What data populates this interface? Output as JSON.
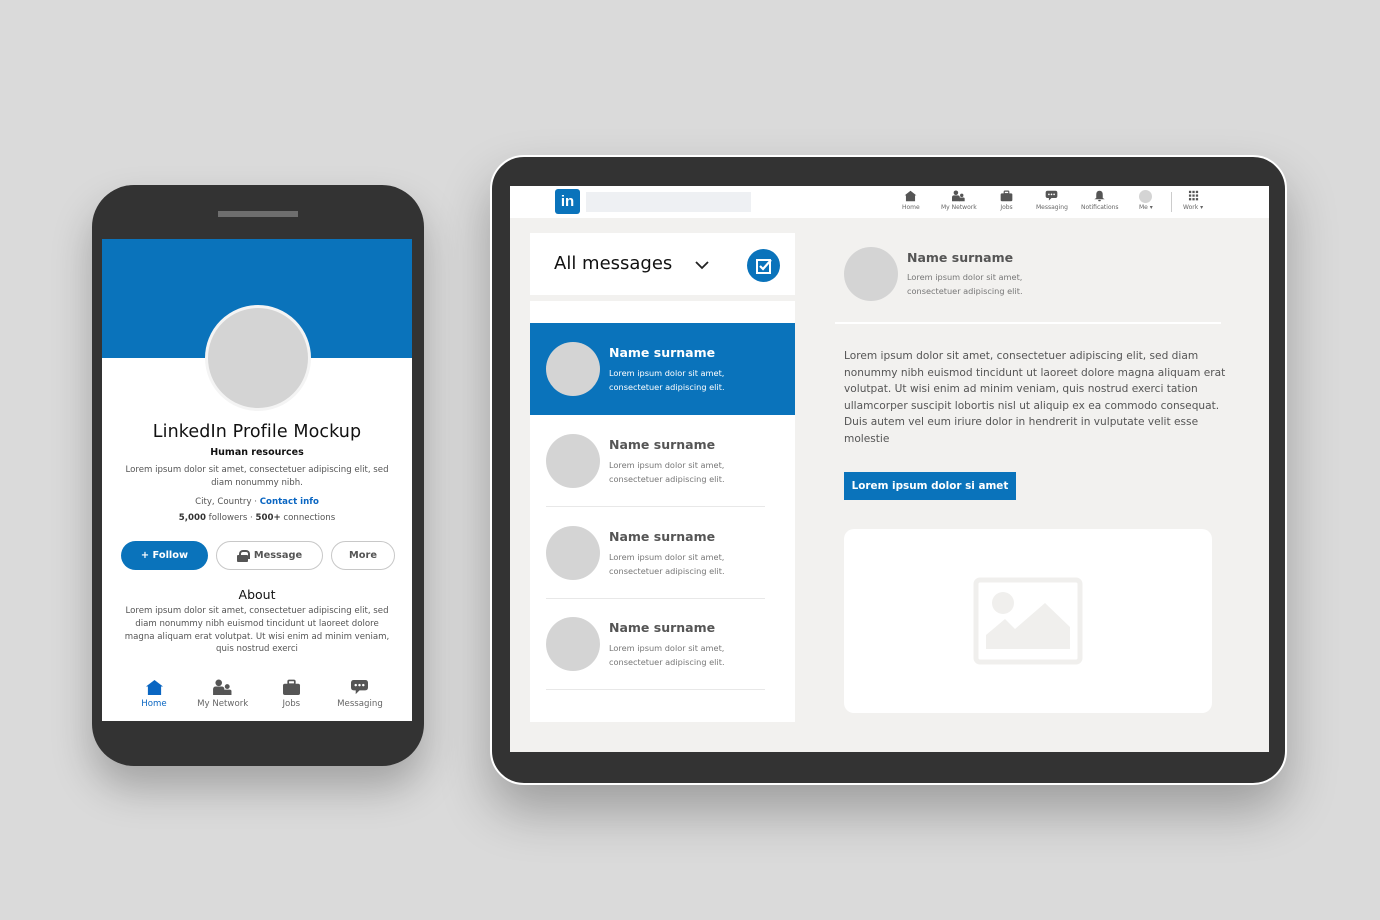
{
  "colors": {
    "brand_blue": "#0a73bb",
    "link_blue": "#0a66c2",
    "device_frame": "#333333",
    "background": "#dadada",
    "tablet_screen_bg": "#f2f1ef",
    "placeholder_gray": "#d4d4d4"
  },
  "phone": {
    "profile": {
      "name": "LinkedIn Profile Mockup",
      "headline": "Human resources",
      "summary": "Lorem ipsum dolor sit amet, consectetuer adipiscing elit, sed diam nonummy nibh.",
      "location": "City, Country",
      "location_separator": " · ",
      "contact_link": "Contact info",
      "followers_count": "5,000",
      "followers_label": " followers · ",
      "connections_count": "500+",
      "connections_label": " connections"
    },
    "buttons": {
      "follow": "+ Follow",
      "message": "Message",
      "more": "More"
    },
    "about": {
      "title": "About",
      "text": "Lorem ipsum dolor sit amet, consectetuer adipiscing elit, sed diam nonummy nibh euismod tincidunt ut laoreet dolore magna aliquam erat volutpat. Ut wisi enim ad minim veniam, quis nostrud exerci"
    },
    "bottom_nav": [
      {
        "label": "Home",
        "icon": "home-icon",
        "active": true
      },
      {
        "label": "My Network",
        "icon": "people-icon",
        "active": false
      },
      {
        "label": "Jobs",
        "icon": "briefcase-icon",
        "active": false
      },
      {
        "label": "Messaging",
        "icon": "chat-icon",
        "active": false
      }
    ]
  },
  "tablet": {
    "logo_text": "in",
    "search": {
      "value": "",
      "placeholder": ""
    },
    "top_nav": [
      {
        "label": "Home",
        "icon": "home-icon"
      },
      {
        "label": "My Network",
        "icon": "people-icon"
      },
      {
        "label": "Jobs",
        "icon": "briefcase-icon"
      },
      {
        "label": "Messaging",
        "icon": "chat-icon"
      },
      {
        "label": "Notifications",
        "icon": "bell-icon"
      },
      {
        "label": "Me ▾",
        "icon": "avatar"
      },
      {
        "label": "Work ▾",
        "icon": "grid-icon"
      }
    ],
    "messages": {
      "title": "All messages",
      "items": [
        {
          "name": "Name surname",
          "snippet": "Lorem ipsum dolor sit amet, consectetuer adipiscing elit.",
          "active": true
        },
        {
          "name": "Name surname",
          "snippet": "Lorem ipsum dolor sit amet, consectetuer adipiscing elit.",
          "active": false
        },
        {
          "name": "Name surname",
          "snippet": "Lorem ipsum dolor sit amet, consectetuer adipiscing elit.",
          "active": false
        },
        {
          "name": "Name surname",
          "snippet": "Lorem ipsum dolor sit amet, consectetuer adipiscing elit.",
          "active": false
        }
      ]
    },
    "conversation": {
      "name": "Name surname",
      "subtitle": "Lorem ipsum dolor sit amet, consectetuer adipiscing elit.",
      "body": "Lorem ipsum dolor sit amet, consectetuer adipiscing elit, sed diam nonummy nibh euismod tincidunt ut laoreet dolore magna aliquam erat volutpat. Ut wisi enim ad minim veniam, quis nostrud exerci tation ullamcorper suscipit lobortis nisl ut aliquip ex ea commodo consequat. Duis autem vel eum iriure dolor in hendrerit in vulputate velit esse molestie",
      "button_label": "Lorem ipsum dolor si amet",
      "media_icon": "image-placeholder-icon"
    }
  }
}
